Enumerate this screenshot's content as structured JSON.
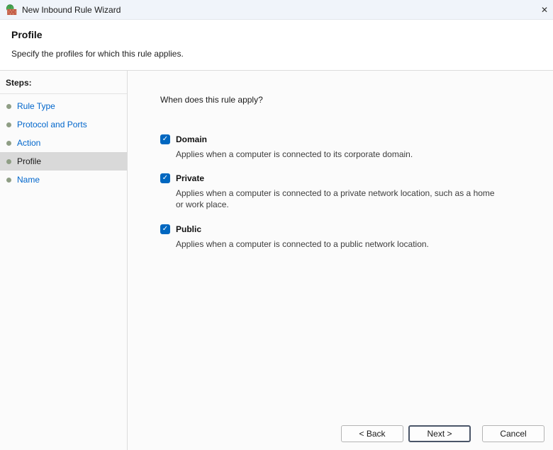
{
  "window": {
    "title": "New Inbound Rule Wizard"
  },
  "glyphs": {
    "check": "✓",
    "close": "✕"
  },
  "header": {
    "title": "Profile",
    "subtitle": "Specify the profiles for which this rule applies."
  },
  "sidebar": {
    "heading": "Steps:",
    "items": [
      {
        "label": "Rule Type",
        "active": false
      },
      {
        "label": "Protocol and Ports",
        "active": false
      },
      {
        "label": "Action",
        "active": false
      },
      {
        "label": "Profile",
        "active": true
      },
      {
        "label": "Name",
        "active": false
      }
    ]
  },
  "content": {
    "question": "When does this rule apply?",
    "options": [
      {
        "label": "Domain",
        "checked": true,
        "description": "Applies when a computer is connected to its corporate domain."
      },
      {
        "label": "Private",
        "checked": true,
        "description": "Applies when a computer is connected to a private network location, such as a home or work place."
      },
      {
        "label": "Public",
        "checked": true,
        "description": "Applies when a computer is connected to a public network location."
      }
    ]
  },
  "footer": {
    "back_label": "< Back",
    "next_label": "Next >",
    "cancel_label": "Cancel"
  },
  "colors": {
    "accent": "#0067c0",
    "link": "#0066cc"
  }
}
